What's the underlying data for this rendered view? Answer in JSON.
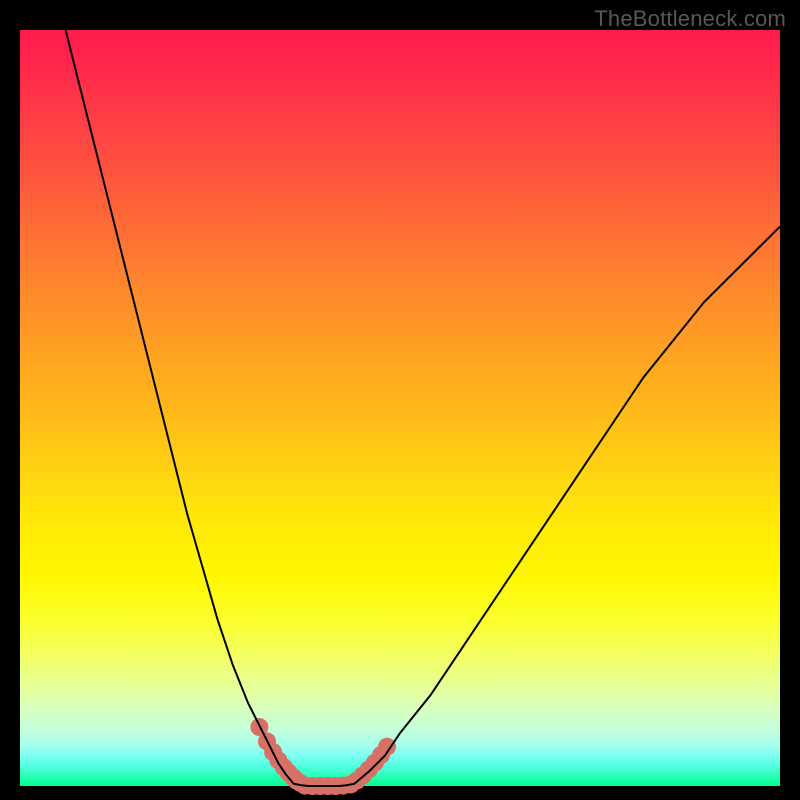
{
  "attribution": "TheBottleneck.com",
  "chart_data": {
    "type": "line",
    "title": "",
    "xlabel": "",
    "ylabel": "",
    "xlim": [
      0,
      100
    ],
    "ylim": [
      0,
      100
    ],
    "series": [
      {
        "name": "left-curve",
        "x": [
          6,
          8,
          10,
          12,
          14,
          16,
          18,
          20,
          22,
          24,
          26,
          28,
          30,
          32,
          33,
          34,
          35,
          36
        ],
        "values": [
          100,
          92,
          84,
          76,
          68,
          60,
          52,
          44,
          36,
          29,
          22,
          16,
          11,
          7,
          5,
          3,
          1.5,
          0.3
        ]
      },
      {
        "name": "floor",
        "x": [
          36,
          37,
          38,
          39,
          40,
          41,
          42,
          43,
          44
        ],
        "values": [
          0.3,
          0.1,
          0,
          0,
          0,
          0,
          0,
          0.1,
          0.3
        ]
      },
      {
        "name": "right-curve",
        "x": [
          44,
          46,
          48,
          50,
          54,
          58,
          62,
          66,
          70,
          74,
          78,
          82,
          86,
          90,
          94,
          98,
          100
        ],
        "values": [
          0.3,
          2,
          4,
          7,
          12,
          18,
          24,
          30,
          36,
          42,
          48,
          54,
          59,
          64,
          68,
          72,
          74
        ]
      }
    ],
    "markers": [
      {
        "name": "left-highlight",
        "x": [
          31.5,
          32.5,
          33.3,
          34.0,
          34.7,
          35.3,
          35.9,
          36.4,
          36.9
        ],
        "y": [
          7.8,
          5.9,
          4.5,
          3.4,
          2.5,
          1.8,
          1.2,
          0.7,
          0.4
        ]
      },
      {
        "name": "floor-highlight",
        "x": [
          37.5,
          38.5,
          39.5,
          40.5,
          41.5,
          42.5
        ],
        "y": [
          0.05,
          0,
          0,
          0,
          0,
          0.05
        ]
      },
      {
        "name": "right-highlight",
        "x": [
          43.5,
          44.3,
          45.1,
          45.9,
          46.7,
          47.5,
          48.3
        ],
        "y": [
          0.2,
          0.7,
          1.4,
          2.2,
          3.1,
          4.1,
          5.2
        ]
      }
    ],
    "style": {
      "line_color": "#000000",
      "line_width": 2,
      "marker_color": "#d77167",
      "marker_radius": 9,
      "background": "rainbow-vertical-gradient"
    }
  }
}
